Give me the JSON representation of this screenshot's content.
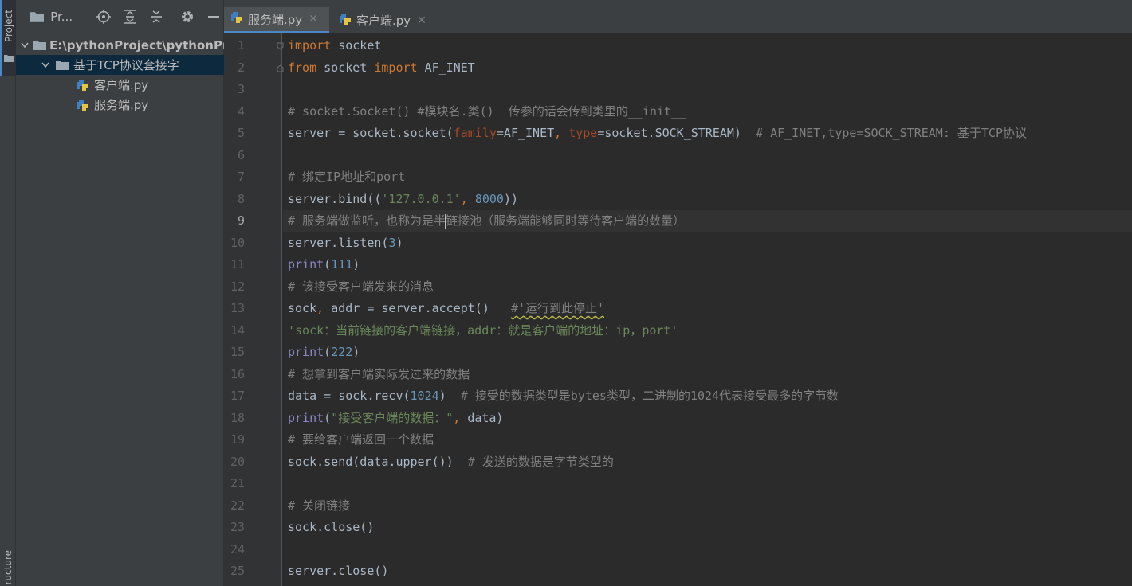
{
  "sidebar_stripe": {
    "project_tab": "Project",
    "structure_tab": "ructure"
  },
  "project_panel": {
    "title": "Pr...",
    "tree": [
      {
        "label": "E:\\pythonProject\\pythonPr",
        "level": 0,
        "type": "root",
        "expanded": true
      },
      {
        "label": "基于TCP协议套接字",
        "level": 1,
        "type": "folder",
        "expanded": true,
        "selected": true
      },
      {
        "label": "客户端.py",
        "level": 2,
        "type": "python-file"
      },
      {
        "label": "服务端.py",
        "level": 2,
        "type": "python-file"
      }
    ]
  },
  "editor": {
    "tabs": [
      {
        "label": "服务端.py",
        "active": true
      },
      {
        "label": "客户端.py",
        "active": false
      }
    ],
    "current_line": 9,
    "lines": [
      [
        [
          "kw",
          "import"
        ],
        [
          "t",
          " socket"
        ]
      ],
      [
        [
          "kw",
          "from"
        ],
        [
          "t",
          " socket "
        ],
        [
          "kw",
          "import"
        ],
        [
          "t",
          " AF_INET"
        ]
      ],
      [],
      [
        [
          "cm",
          "# socket.Socket() #模块名.类()  传参的话会传到类里的__init__"
        ]
      ],
      [
        [
          "t",
          "server = socket.socket("
        ],
        [
          "param",
          "family"
        ],
        [
          "t",
          "=AF_INET"
        ],
        [
          "kw",
          ", "
        ],
        [
          "param",
          "type"
        ],
        [
          "t",
          "=socket.SOCK_STREAM)  "
        ],
        [
          "cm",
          "# AF_INET,type=SOCK_STREAM: 基于TCP协议"
        ]
      ],
      [],
      [
        [
          "cm",
          "# 绑定IP地址和port"
        ]
      ],
      [
        [
          "t",
          "server.bind(("
        ],
        [
          "str",
          "'127.0.0.1'"
        ],
        [
          "kw",
          ", "
        ],
        [
          "num",
          "8000"
        ],
        [
          "t",
          "))"
        ]
      ],
      [
        [
          "cm",
          "# 服务端做监听，也称为是半"
        ],
        [
          "caret",
          ""
        ],
        [
          "cm",
          "链接池（服务端能够同时等待客户端的数量）"
        ]
      ],
      [
        [
          "t",
          "server.listen("
        ],
        [
          "num",
          "3"
        ],
        [
          "t",
          ")"
        ]
      ],
      [
        [
          "bi",
          "print"
        ],
        [
          "t",
          "("
        ],
        [
          "num",
          "111"
        ],
        [
          "t",
          ")"
        ]
      ],
      [
        [
          "cm",
          "# 该接受客户端发来的消息"
        ]
      ],
      [
        [
          "t",
          "sock"
        ],
        [
          "kw",
          ", "
        ],
        [
          "t",
          "addr = server.accept()   "
        ],
        [
          "squig",
          "#'运行到此停止'"
        ]
      ],
      [
        [
          "str",
          "'sock：当前链接的客户端链接，addr：就是客户端的地址：ip，port'"
        ]
      ],
      [
        [
          "bi",
          "print"
        ],
        [
          "t",
          "("
        ],
        [
          "num",
          "222"
        ],
        [
          "t",
          ")"
        ]
      ],
      [
        [
          "cm",
          "# 想拿到客户端实际发过来的数据"
        ]
      ],
      [
        [
          "t",
          "data = sock.recv("
        ],
        [
          "num",
          "1024"
        ],
        [
          "t",
          ")  "
        ],
        [
          "cm",
          "# 接受的数据类型是bytes类型，二进制的1024代表接受最多的字节数"
        ]
      ],
      [
        [
          "bi",
          "print"
        ],
        [
          "t",
          "("
        ],
        [
          "str",
          "\"接受客户端的数据：\""
        ],
        [
          "kw",
          ", "
        ],
        [
          "t",
          "data)"
        ]
      ],
      [
        [
          "cm",
          "# 要给客户端返回一个数据"
        ]
      ],
      [
        [
          "t",
          "sock.send(data.upper())  "
        ],
        [
          "cm",
          "# 发送的数据是字节类型的"
        ]
      ],
      [],
      [
        [
          "cm",
          "# 关闭链接"
        ]
      ],
      [
        [
          "t",
          "sock.close()"
        ]
      ],
      [],
      [
        [
          "t",
          "server.close()"
        ]
      ]
    ]
  }
}
